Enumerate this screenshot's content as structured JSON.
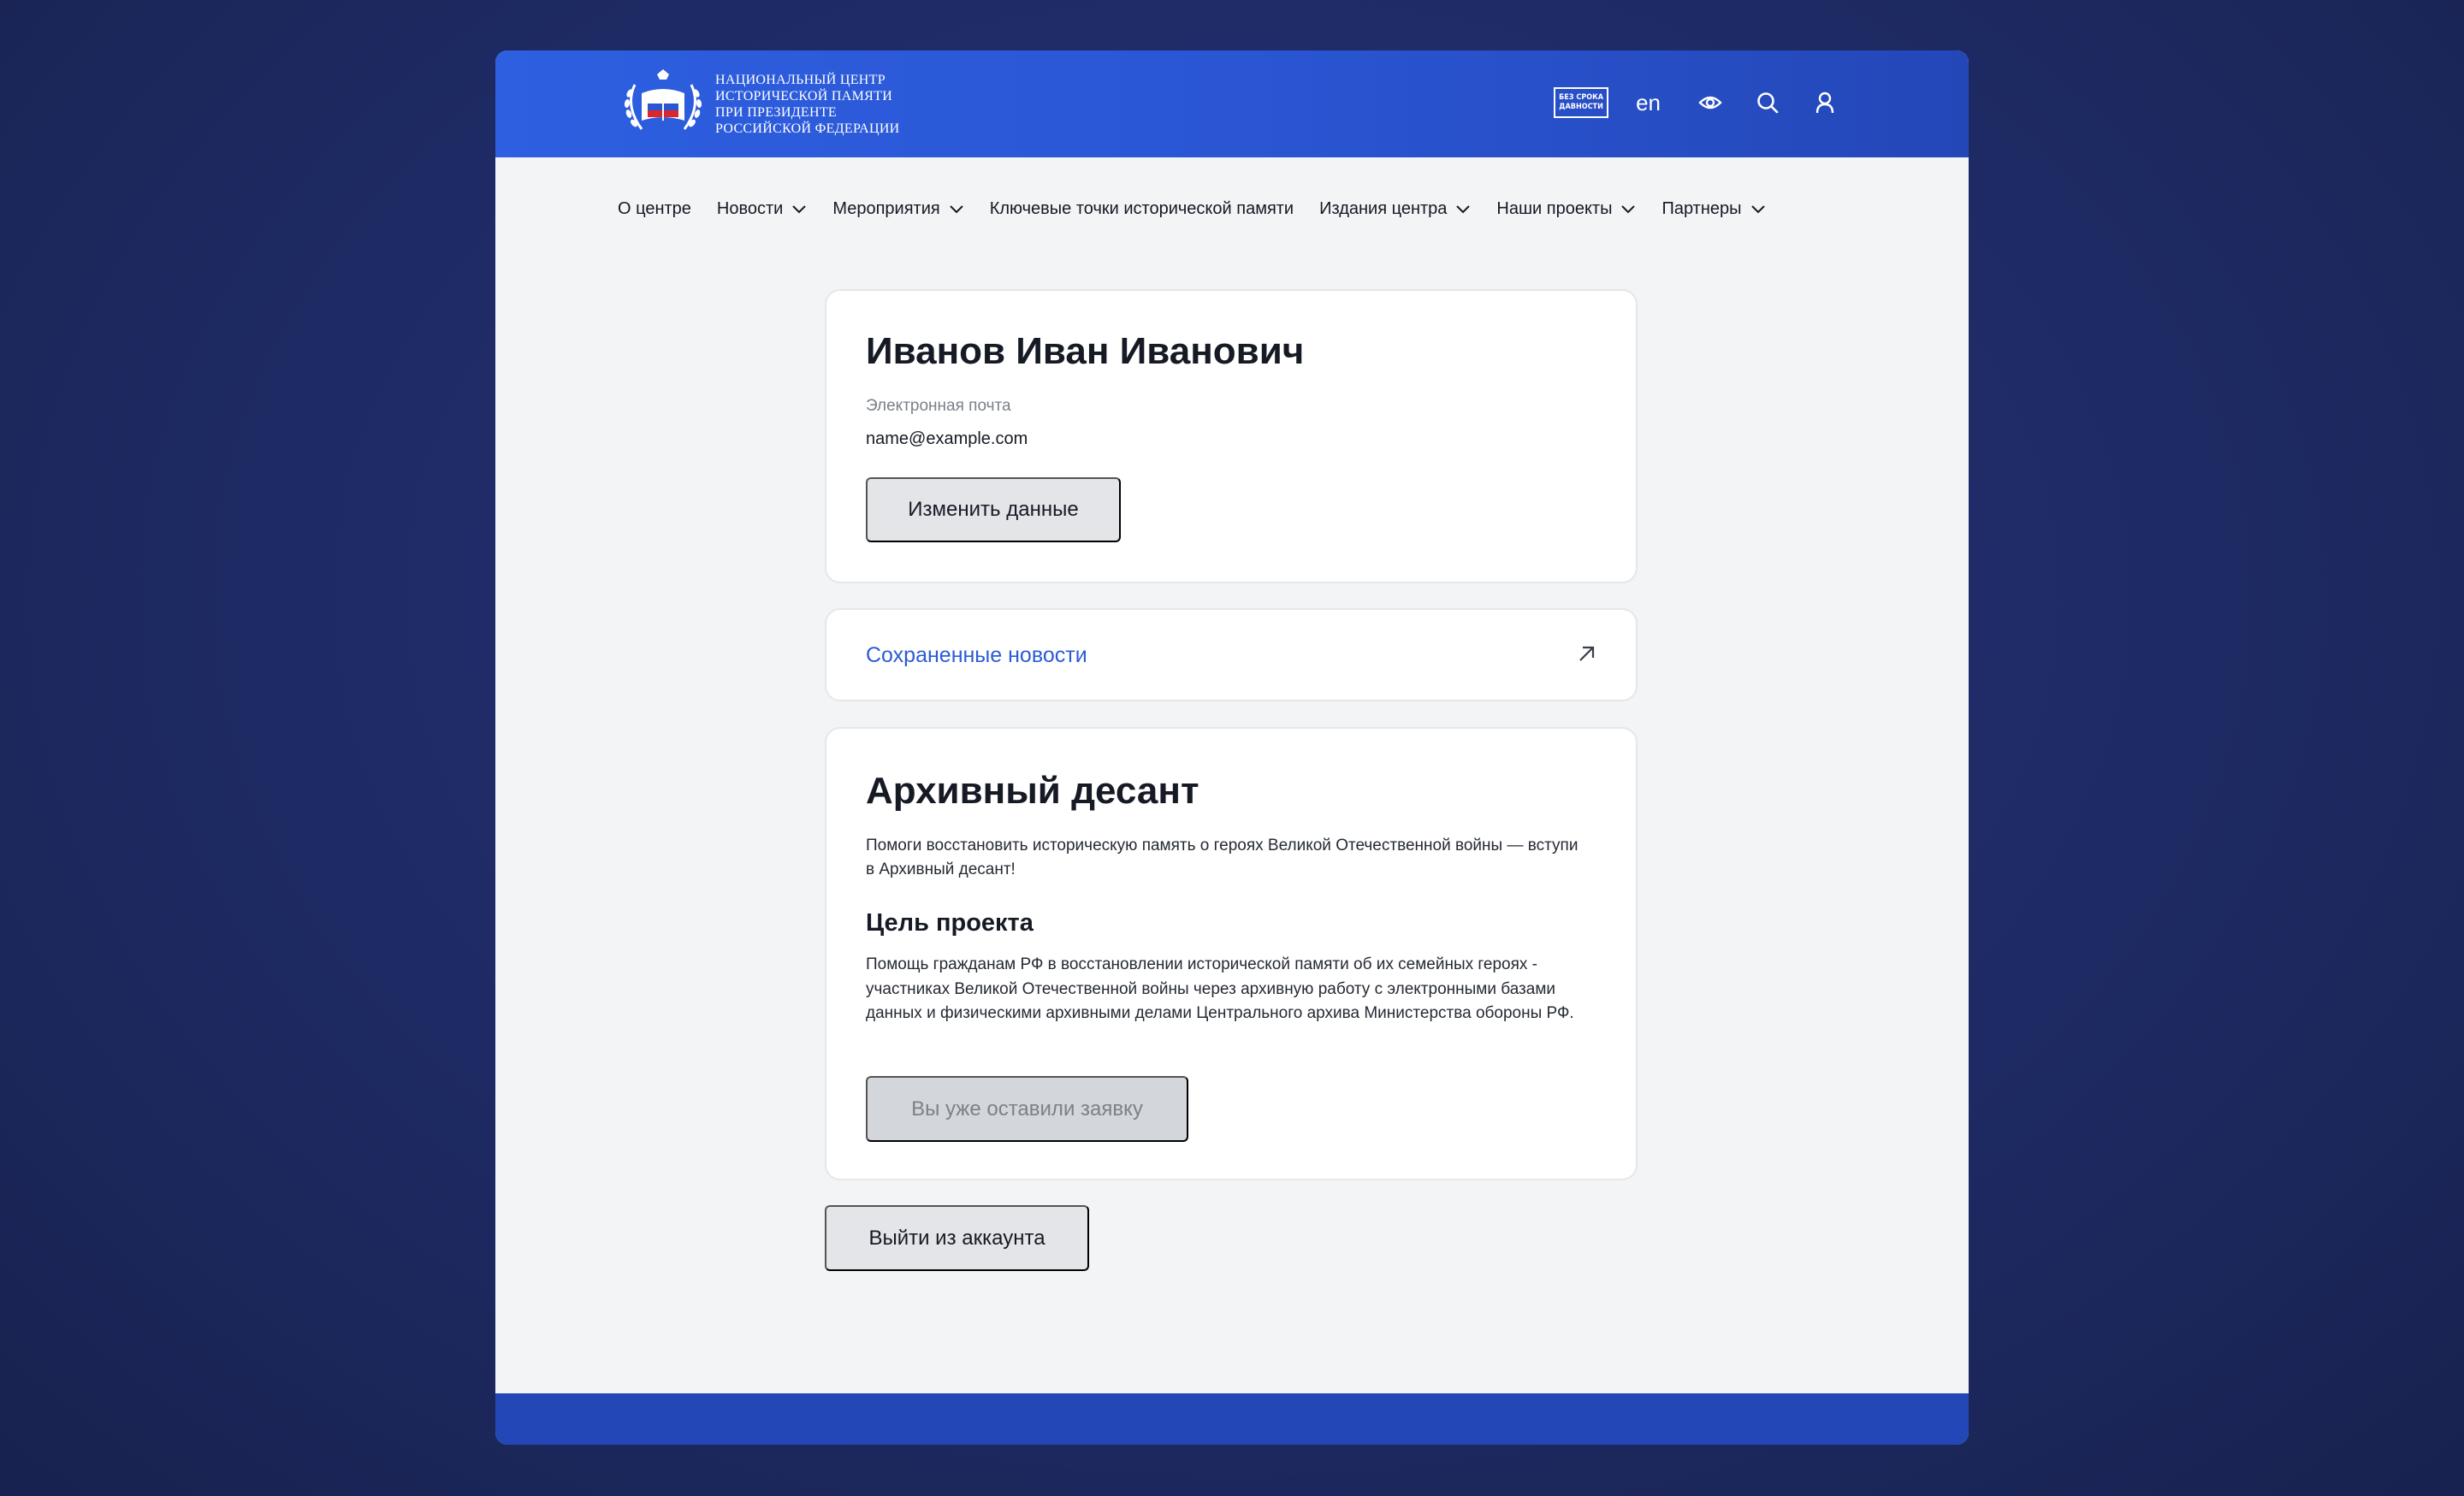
{
  "header": {
    "logo_lines": [
      "Национальный центр",
      "исторической памяти",
      "при Президенте",
      "Российской Федерации"
    ],
    "badge_lines": [
      "БЕЗ СРОКА",
      "ДАВНОСТИ"
    ],
    "lang": "en",
    "icons": [
      "eye-icon",
      "search-icon",
      "user-icon"
    ]
  },
  "nav": {
    "items": [
      {
        "label": "О центре",
        "dropdown": false
      },
      {
        "label": "Новости",
        "dropdown": true
      },
      {
        "label": "Мероприятия",
        "dropdown": true
      },
      {
        "label": "Ключевые точки исторической памяти",
        "dropdown": false
      },
      {
        "label": "Издания центра",
        "dropdown": true
      },
      {
        "label": "Наши проекты",
        "dropdown": true
      },
      {
        "label": "Партнеры",
        "dropdown": true
      }
    ]
  },
  "profile": {
    "name": "Иванов Иван Иванович",
    "email_label": "Электронная почта",
    "email": "name@example.com",
    "edit_button": "Изменить данные"
  },
  "saved": {
    "label": "Сохраненные новости"
  },
  "project": {
    "title": "Архивный десант",
    "description": "Помоги восстановить историческую память о героях Великой Отечественной войны — вступи в Архивный десант!",
    "goal_title": "Цель проекта",
    "goal_text": "Помощь гражданам РФ в восстановлении исторической памяти об их семейных героях - участниках Великой Отечественной войны через архивную работу с электронными базами данных и физическими архивными делами Центрального архива Министерства обороны РФ.",
    "applied_button": "Вы уже оставили заявку"
  },
  "logout_button": "Выйти из аккаунта",
  "colors": {
    "header_blue": "#2d5fe0",
    "link_blue": "#2b5bd6",
    "page_bg": "#1f2b66"
  }
}
